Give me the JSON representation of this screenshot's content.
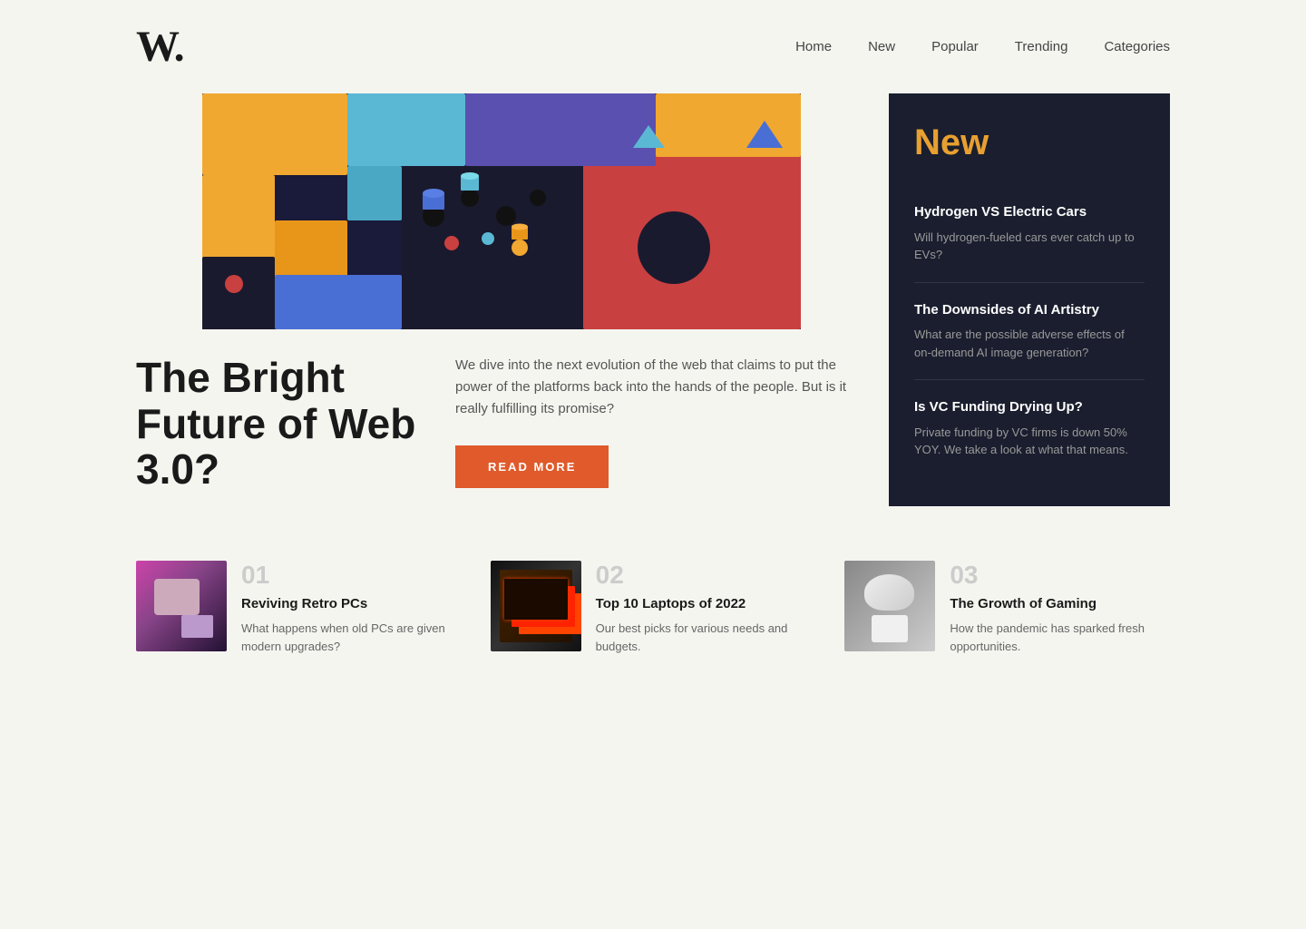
{
  "logo": "W.",
  "nav": {
    "items": [
      {
        "label": "Home",
        "id": "home"
      },
      {
        "label": "New",
        "id": "new"
      },
      {
        "label": "Popular",
        "id": "popular"
      },
      {
        "label": "Trending",
        "id": "trending"
      },
      {
        "label": "Categories",
        "id": "categories"
      }
    ]
  },
  "hero": {
    "title": "The Bright Future of Web 3.0?",
    "description": "We dive into the next evolution of the web that claims to put the power of the platforms back into the hands of the people. But is it really fulfilling its promise?",
    "read_more_label": "READ MORE"
  },
  "new_section": {
    "label": "New",
    "articles": [
      {
        "title": "Hydrogen VS Electric Cars",
        "description": "Will hydrogen-fueled cars ever catch up to EVs?"
      },
      {
        "title": "The Downsides of AI Artistry",
        "description": "What are the possible adverse effects of on-demand AI image generation?"
      },
      {
        "title": "Is VC Funding Drying Up?",
        "description": "Private funding by VC firms is down 50% YOY. We take a look at what that means."
      }
    ]
  },
  "numbered_articles": [
    {
      "number": "01",
      "title": "Reviving Retro PCs",
      "description": "What happens when old PCs are given modern upgrades?",
      "thumb_type": "retro"
    },
    {
      "number": "02",
      "title": "Top 10 Laptops of 2022",
      "description": "Our best picks for various needs and budgets.",
      "thumb_type": "laptops"
    },
    {
      "number": "03",
      "title": "The Growth of Gaming",
      "description": "How the pandemic has sparked fresh opportunities.",
      "thumb_type": "gaming"
    }
  ]
}
